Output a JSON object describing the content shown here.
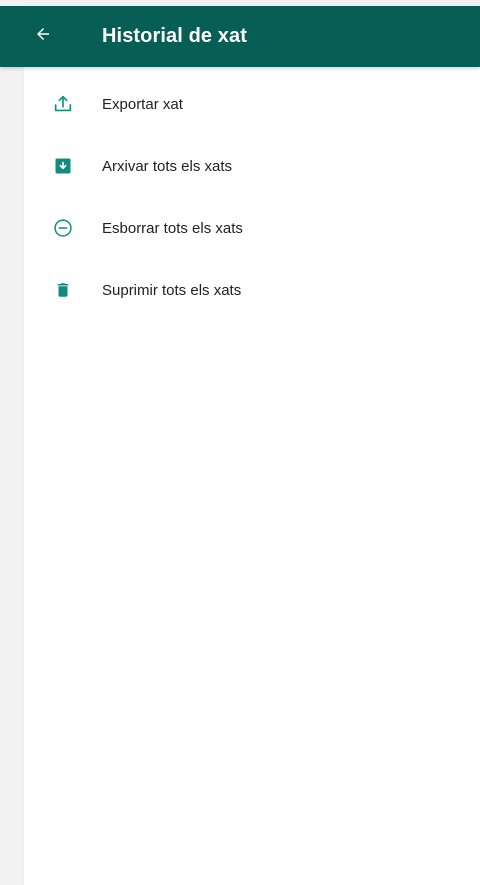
{
  "colors": {
    "appbar": "#075e54",
    "icon": "#128c7e",
    "text": "#222222"
  },
  "header": {
    "back_icon": "arrow-left-icon",
    "title": "Historial de xat"
  },
  "menu": {
    "items": [
      {
        "icon": "share-upload-icon",
        "label": "Exportar xat"
      },
      {
        "icon": "archive-icon",
        "label": "Arxivar tots els xats"
      },
      {
        "icon": "minus-circle-icon",
        "label": "Esborrar tots els xats"
      },
      {
        "icon": "trash-icon",
        "label": "Suprimir tots els xats"
      }
    ]
  }
}
